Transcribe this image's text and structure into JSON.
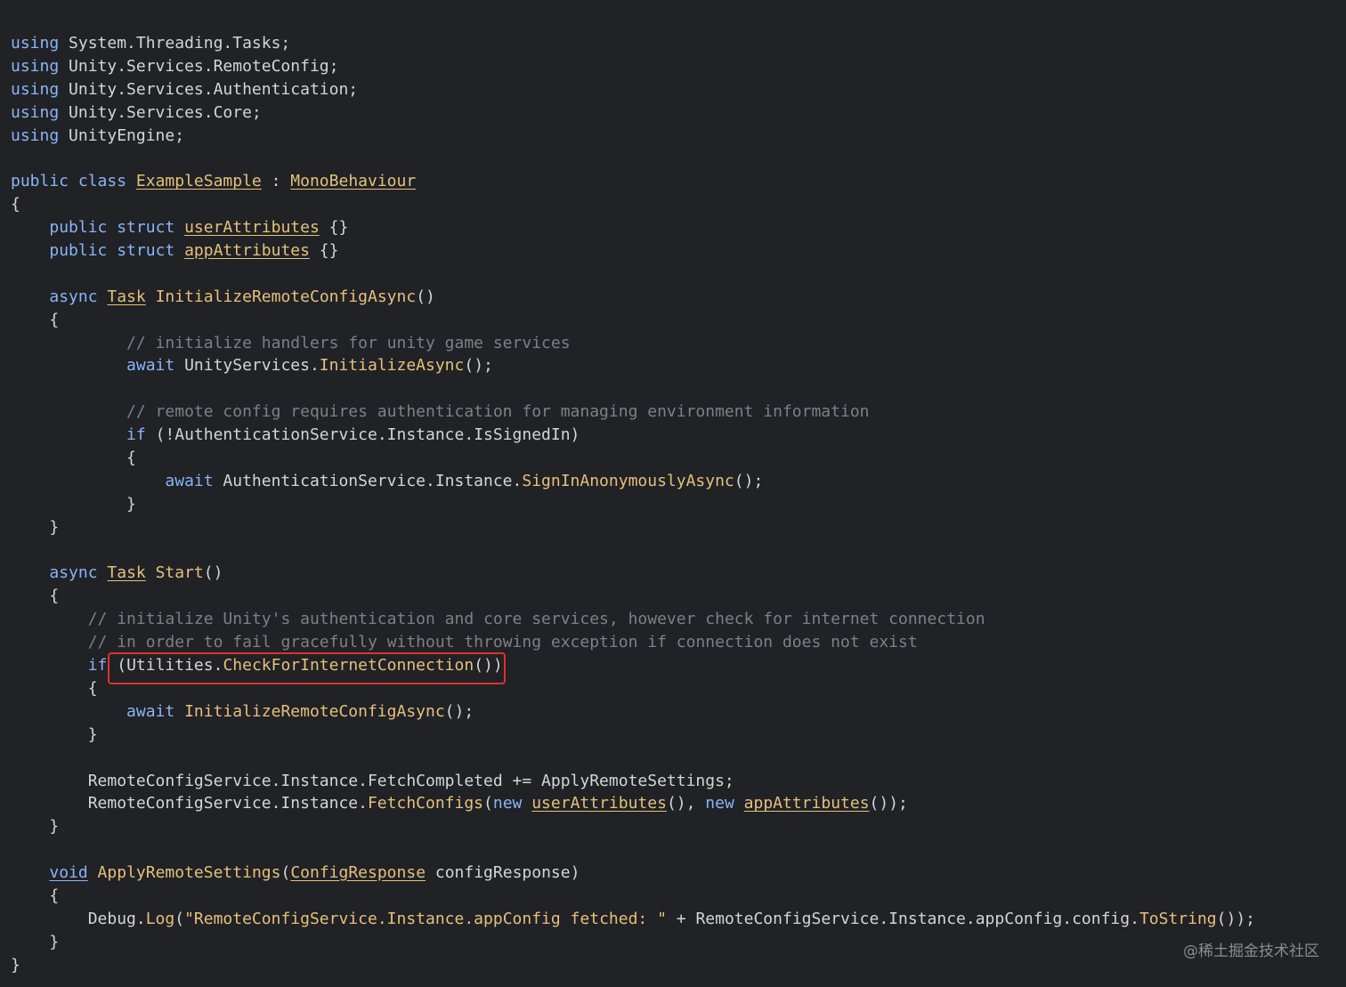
{
  "code": {
    "lines": [
      [
        [
          "kw",
          "using"
        ],
        [
          "pl",
          " System.Threading.Tasks;"
        ]
      ],
      [
        [
          "kw",
          "using"
        ],
        [
          "pl",
          " Unity.Services.RemoteConfig;"
        ]
      ],
      [
        [
          "kw",
          "using"
        ],
        [
          "pl",
          " Unity.Services.Authentication;"
        ]
      ],
      [
        [
          "kw",
          "using"
        ],
        [
          "pl",
          " Unity.Services.Core;"
        ]
      ],
      [
        [
          "kw",
          "using"
        ],
        [
          "pl",
          " UnityEngine;"
        ]
      ],
      [],
      [
        [
          "kw",
          "public class "
        ],
        [
          "ty",
          "ExampleSample"
        ],
        [
          "pl",
          " : "
        ],
        [
          "ty",
          "MonoBehaviour"
        ]
      ],
      [
        [
          "pl",
          "{"
        ]
      ],
      [
        [
          "pl",
          "    "
        ],
        [
          "kw",
          "public struct "
        ],
        [
          "ty",
          "userAttributes"
        ],
        [
          "pl",
          " {}"
        ]
      ],
      [
        [
          "pl",
          "    "
        ],
        [
          "kw",
          "public struct "
        ],
        [
          "ty",
          "appAttributes"
        ],
        [
          "pl",
          " {}"
        ]
      ],
      [],
      [
        [
          "pl",
          "    "
        ],
        [
          "kw",
          "async "
        ],
        [
          "ty",
          "Task"
        ],
        [
          "fn",
          " InitializeRemoteConfigAsync"
        ],
        [
          "pl",
          "()"
        ]
      ],
      [
        [
          "pl",
          "    {"
        ]
      ],
      [
        [
          "pl",
          "            "
        ],
        [
          "cm",
          "// initialize handlers for unity game services"
        ]
      ],
      [
        [
          "pl",
          "            "
        ],
        [
          "kw",
          "await"
        ],
        [
          "pl",
          " UnityServices."
        ],
        [
          "fn",
          "InitializeAsync"
        ],
        [
          "pl",
          "();"
        ]
      ],
      [],
      [
        [
          "pl",
          "            "
        ],
        [
          "cm",
          "// remote config requires authentication for managing environment information"
        ]
      ],
      [
        [
          "pl",
          "            "
        ],
        [
          "kw",
          "if"
        ],
        [
          "pl",
          " (!AuthenticationService.Instance.IsSignedIn)"
        ]
      ],
      [
        [
          "pl",
          "            {"
        ]
      ],
      [
        [
          "pl",
          "                "
        ],
        [
          "kw",
          "await"
        ],
        [
          "pl",
          " AuthenticationService.Instance."
        ],
        [
          "fn",
          "SignInAnonymouslyAsync"
        ],
        [
          "pl",
          "();"
        ]
      ],
      [
        [
          "pl",
          "            }"
        ]
      ],
      [
        [
          "pl",
          "    }"
        ]
      ],
      [],
      [
        [
          "pl",
          "    "
        ],
        [
          "kw",
          "async "
        ],
        [
          "ty",
          "Task"
        ],
        [
          "fn",
          " Start"
        ],
        [
          "pl",
          "()"
        ]
      ],
      [
        [
          "pl",
          "    {"
        ]
      ],
      [
        [
          "pl",
          "        "
        ],
        [
          "cm",
          "// initialize Unity's authentication and core services, however check for internet connection"
        ]
      ],
      [
        [
          "pl",
          "        "
        ],
        [
          "cm",
          "// in order to fail gracefully without throwing exception if connection does not exist"
        ]
      ],
      [
        [
          "pl",
          "        "
        ],
        [
          "kw",
          "if"
        ],
        [
          "pl",
          " (Utilities."
        ],
        [
          "fn",
          "CheckForInternetConnection"
        ],
        [
          "pl",
          "())"
        ]
      ],
      [
        [
          "pl",
          "        {"
        ]
      ],
      [
        [
          "pl",
          "            "
        ],
        [
          "kw",
          "await"
        ],
        [
          "fn",
          " InitializeRemoteConfigAsync"
        ],
        [
          "pl",
          "();"
        ]
      ],
      [
        [
          "pl",
          "        }"
        ]
      ],
      [],
      [
        [
          "pl",
          "        RemoteConfigService.Instance.FetchCompleted += ApplyRemoteSettings;"
        ]
      ],
      [
        [
          "pl",
          "        RemoteConfigService.Instance."
        ],
        [
          "fn",
          "FetchConfigs"
        ],
        [
          "pl",
          "("
        ],
        [
          "kw",
          "new "
        ],
        [
          "ty",
          "userAttributes"
        ],
        [
          "pl",
          "(), "
        ],
        [
          "kw",
          "new "
        ],
        [
          "ty",
          "appAttributes"
        ],
        [
          "pl",
          "());"
        ]
      ],
      [
        [
          "pl",
          "    }"
        ]
      ],
      [],
      [
        [
          "pl",
          "    "
        ],
        [
          "tyk",
          "void"
        ],
        [
          "fn",
          " ApplyRemoteSettings"
        ],
        [
          "pl",
          "("
        ],
        [
          "ty",
          "ConfigResponse"
        ],
        [
          "pl",
          " configResponse)"
        ]
      ],
      [
        [
          "pl",
          "    {"
        ]
      ],
      [
        [
          "pl",
          "        Debug."
        ],
        [
          "fn",
          "Log"
        ],
        [
          "pl",
          "("
        ],
        [
          "st",
          "\"RemoteConfigService.Instance.appConfig fetched: \""
        ],
        [
          "pl",
          " + RemoteConfigService.Instance.appConfig.config."
        ],
        [
          "fn",
          "ToString"
        ],
        [
          "pl",
          "());"
        ]
      ],
      [
        [
          "pl",
          "    }"
        ]
      ],
      [
        [
          "pl",
          "}"
        ]
      ]
    ]
  },
  "watermark": "@稀土掘金技术社区",
  "colors": {
    "background": "#202225",
    "keyword": "#8ab4f8",
    "plain": "#d3d5d9",
    "function": "#e6c07b",
    "comment": "#7c8088",
    "highlight_box": "#e0312c"
  }
}
